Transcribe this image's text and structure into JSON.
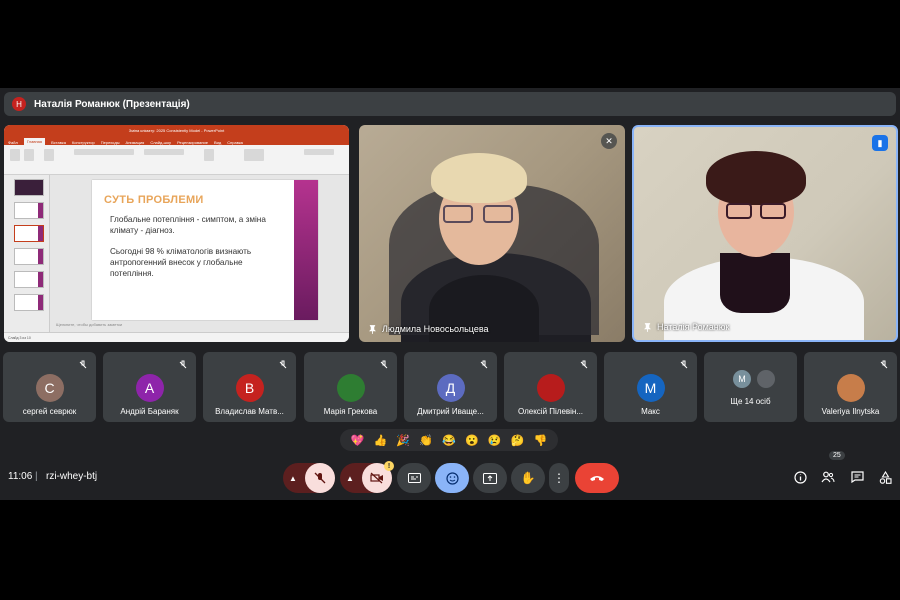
{
  "presenter": {
    "initial": "Н",
    "title": "Наталія Романюк (Презентація)"
  },
  "ppt": {
    "window_title": "Зміна клімату: 2025 Consistently Model - PowerPoint",
    "tabs": [
      "Файл",
      "Главная",
      "Вставка",
      "Конструктор",
      "Переходы",
      "Анимация",
      "Слайд-шоу",
      "Рецензирование",
      "Вид",
      "Справка"
    ],
    "slide_title": "СУТЬ ПРОБЛЕМИ",
    "slide_text_1": "Глобальне потепління - симптом, а зміна клімату - діагноз.",
    "slide_text_2": "Сьогодні 98 % кліматологів визнають антропогенний внесок у глобальне потепління.",
    "notes": "Щелкните, чтобы добавить заметки",
    "status": "Слайд 3 из 10"
  },
  "cameras": [
    {
      "name": "Людмила Новосьольцева"
    },
    {
      "name": "Наталія Романюк"
    }
  ],
  "participants": [
    {
      "initial": "С",
      "color": "#8d6e63",
      "name": "сергей севрюк"
    },
    {
      "initial": "А",
      "color": "#8e24aa",
      "name": "Андрій Бараняк"
    },
    {
      "initial": "В",
      "color": "#c5221f",
      "name": "Владислав Матв..."
    },
    {
      "initial": "",
      "color": "#2e7d32",
      "name": "Марія Грекова"
    },
    {
      "initial": "Д",
      "color": "#5c6bc0",
      "name": "Дмитрий Иваще..."
    },
    {
      "initial": "",
      "color": "#b71c1c",
      "name": "Олексій Пілевін..."
    },
    {
      "initial": "М",
      "color": "#1565c0",
      "name": "Макс"
    },
    {
      "initial": "М",
      "color": "#78909c",
      "name": "Ще 14 осіб"
    },
    {
      "initial": "",
      "color": "#c77d4a",
      "name": "Valeriya Ilnytska"
    }
  ],
  "reactions": [
    "💖",
    "👍",
    "🎉",
    "👏",
    "😂",
    "😮",
    "😢",
    "🤔",
    "👎"
  ],
  "toolbar": {
    "time": "11:06",
    "separator": "|",
    "meeting_code": "rzi-whey-btj",
    "people_count": "25"
  },
  "colors": {
    "accent": "#8ab4f8",
    "end_call": "#ea4335",
    "mic_off": "#f9dedc"
  }
}
